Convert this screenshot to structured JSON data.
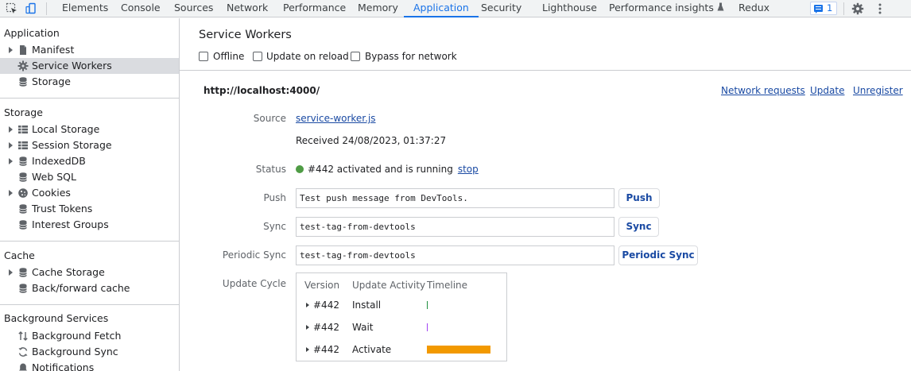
{
  "tabs": [
    {
      "label": "Elements",
      "active": false
    },
    {
      "label": "Console",
      "active": false
    },
    {
      "label": "Sources",
      "active": false
    },
    {
      "label": "Network",
      "active": false
    },
    {
      "label": "Performance",
      "active": false
    },
    {
      "label": "Memory",
      "active": false
    },
    {
      "label": "Application",
      "active": true
    },
    {
      "label": "Security",
      "active": false
    },
    {
      "label": "Lighthouse",
      "active": false
    },
    {
      "label": "Performance insights",
      "active": false,
      "icon": "flask-icon"
    },
    {
      "label": "Redux",
      "active": false
    }
  ],
  "toolbar": {
    "issues_count": "1",
    "icons": [
      "inspect-element-icon",
      "device-toolbar-icon",
      "issues-icon",
      "settings-icon",
      "more-options-icon"
    ]
  },
  "sidebar": {
    "sections": [
      {
        "title": "Application",
        "items": [
          {
            "label": "Manifest",
            "icon": "file-icon",
            "expandable": true
          },
          {
            "label": "Service Workers",
            "icon": "gear-icon",
            "expandable": false,
            "selected": true
          },
          {
            "label": "Storage",
            "icon": "database-icon",
            "expandable": false
          }
        ]
      },
      {
        "title": "Storage",
        "items": [
          {
            "label": "Local Storage",
            "icon": "table-icon",
            "expandable": true
          },
          {
            "label": "Session Storage",
            "icon": "table-icon",
            "expandable": true
          },
          {
            "label": "IndexedDB",
            "icon": "database-icon",
            "expandable": true
          },
          {
            "label": "Web SQL",
            "icon": "database-icon",
            "expandable": false
          },
          {
            "label": "Cookies",
            "icon": "cookie-icon",
            "expandable": true
          },
          {
            "label": "Trust Tokens",
            "icon": "database-icon",
            "expandable": false
          },
          {
            "label": "Interest Groups",
            "icon": "database-icon",
            "expandable": false
          }
        ]
      },
      {
        "title": "Cache",
        "items": [
          {
            "label": "Cache Storage",
            "icon": "database-icon",
            "expandable": true
          },
          {
            "label": "Back/forward cache",
            "icon": "database-icon",
            "expandable": false
          }
        ]
      },
      {
        "title": "Background Services",
        "items": [
          {
            "label": "Background Fetch",
            "icon": "up-down-arrows-icon",
            "expandable": false
          },
          {
            "label": "Background Sync",
            "icon": "sync-icon",
            "expandable": false
          },
          {
            "label": "Notifications",
            "icon": "bell-icon",
            "expandable": false
          }
        ]
      }
    ]
  },
  "main": {
    "title": "Service Workers",
    "options": [
      {
        "label": "Offline",
        "checked": false
      },
      {
        "label": "Update on reload",
        "checked": false
      },
      {
        "label": "Bypass for network",
        "checked": false
      }
    ],
    "origin": "http://localhost:4000/",
    "actions": [
      "Network requests",
      "Update",
      "Unregister"
    ],
    "source_label": "Source",
    "source_file": "service-worker.js",
    "received": "Received 24/08/2023, 01:37:27",
    "status_label": "Status",
    "status_text": "#442 activated and is running",
    "status_color": "#4f9c45",
    "stop_label": "stop",
    "push": {
      "label": "Push",
      "value": "Test push message from DevTools.",
      "button": "Push"
    },
    "sync": {
      "label": "Sync",
      "value": "test-tag-from-devtools",
      "button": "Sync"
    },
    "periodic_sync": {
      "label": "Periodic Sync",
      "value": "test-tag-from-devtools",
      "button": "Periodic Sync"
    },
    "update_cycle": {
      "label": "Update Cycle",
      "headers": [
        "Version",
        "Update Activity",
        "Timeline"
      ],
      "rows": [
        {
          "version": "#442",
          "activity": "Install",
          "color": "#1e8e3e"
        },
        {
          "version": "#442",
          "activity": "Wait",
          "color": "#a142f4"
        },
        {
          "version": "#442",
          "activity": "Activate",
          "color": "#f29900"
        }
      ]
    }
  }
}
